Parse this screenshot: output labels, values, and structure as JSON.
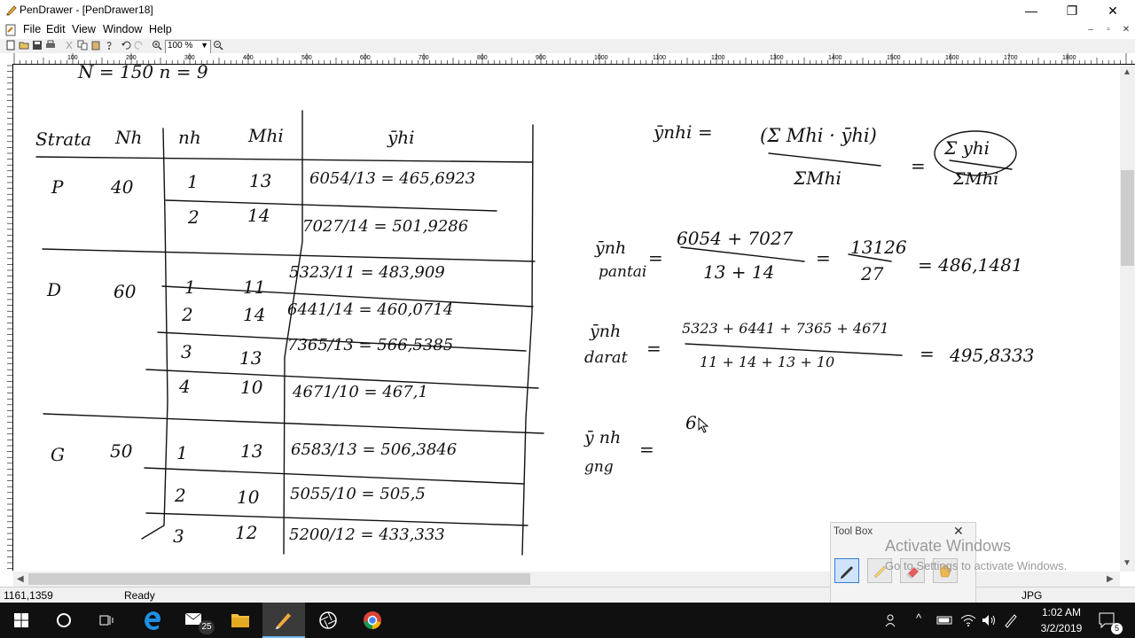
{
  "window": {
    "title": "PenDrawer - [PenDrawer18]",
    "controls": {
      "minimize": "—",
      "restore": "❐",
      "close": "✕"
    }
  },
  "menu": {
    "items": [
      "File",
      "Edit",
      "View",
      "Window",
      "Help"
    ],
    "mdi_controls": {
      "minimize": "–",
      "restore": "▫",
      "close": "✕"
    }
  },
  "toolbar": {
    "zoom_value": "100 %",
    "ruler_labels": [
      "100",
      "200",
      "300",
      "400",
      "500",
      "600",
      "700",
      "800",
      "900",
      "1000",
      "1100",
      "1200",
      "1300",
      "1400",
      "1500",
      "1600",
      "1700",
      "1800"
    ]
  },
  "canvas": {
    "top_partial": "N = 150   n = 9",
    "table": {
      "headers": {
        "strata": "Strata",
        "Nh": "Nh",
        "nh": "nh",
        "Mhi": "Mhi",
        "yhi": "ȳhi"
      },
      "strata": [
        {
          "name": "P",
          "Nh": "40",
          "rows": [
            {
              "nh": "1",
              "Mhi": "13",
              "yhi": "6054/13 = 465,6923"
            },
            {
              "nh": "2",
              "Mhi": "14",
              "yhi": "7027/14 = 501,9286"
            }
          ]
        },
        {
          "name": "D",
          "Nh": "60",
          "rows": [
            {
              "nh": "1",
              "Mhi": "11",
              "yhi": "5323/11 = 483,909"
            },
            {
              "nh": "2",
              "Mhi": "14",
              "yhi": "6441/14 = 460,0714"
            },
            {
              "nh": "3",
              "Mhi": "13",
              "yhi": "7365/13 = 566,5385"
            },
            {
              "nh": "4",
              "Mhi": "10",
              "yhi": "4671/10 = 467,1"
            }
          ]
        },
        {
          "name": "G",
          "Nh": "50",
          "rows": [
            {
              "nh": "1",
              "Mhi": "13",
              "yhi": "6583/13 = 506,3846"
            },
            {
              "nh": "2",
              "Mhi": "10",
              "yhi": "5055/10 = 505,5"
            },
            {
              "nh": "3",
              "Mhi": "12",
              "yhi": "5200/12 = 433,333"
            }
          ]
        }
      ]
    },
    "formula": {
      "lhs": "ȳnhi =",
      "num": "(Σ Mhi · ȳhi)",
      "den": "ΣMhi",
      "eq": "=",
      "num2": "Σ yhi",
      "den2": "ΣMhi"
    },
    "pantai": {
      "label1": "ȳnh",
      "label2": "pantai",
      "eq": "=",
      "num": "6054 + 7027",
      "den": "13 + 14",
      "eq2": "=",
      "frac_num": "13126",
      "frac_den": "27",
      "result": "= 486,1481"
    },
    "darat": {
      "label1": "ȳnh",
      "label2": "darat",
      "eq": "=",
      "num": "5323 + 6441 + 7365 + 4671",
      "den": "11 + 14 + 13 + 10",
      "eq2": "=",
      "result": "495,8333"
    },
    "gunung": {
      "label1": "ȳ nh",
      "label2": "gng",
      "eq": "=",
      "partial": "6"
    }
  },
  "toolbox": {
    "title": "Tool Box",
    "close": "✕"
  },
  "watermark": {
    "title": "Activate Windows",
    "subtitle": "Go to Settings to activate Windows."
  },
  "status": {
    "coords": "1161,1359",
    "text": "Ready",
    "format": "JPG"
  },
  "taskbar": {
    "mail_badge": "25",
    "time": "1:02 AM",
    "date": "3/2/2019",
    "notif_badge": "5"
  }
}
